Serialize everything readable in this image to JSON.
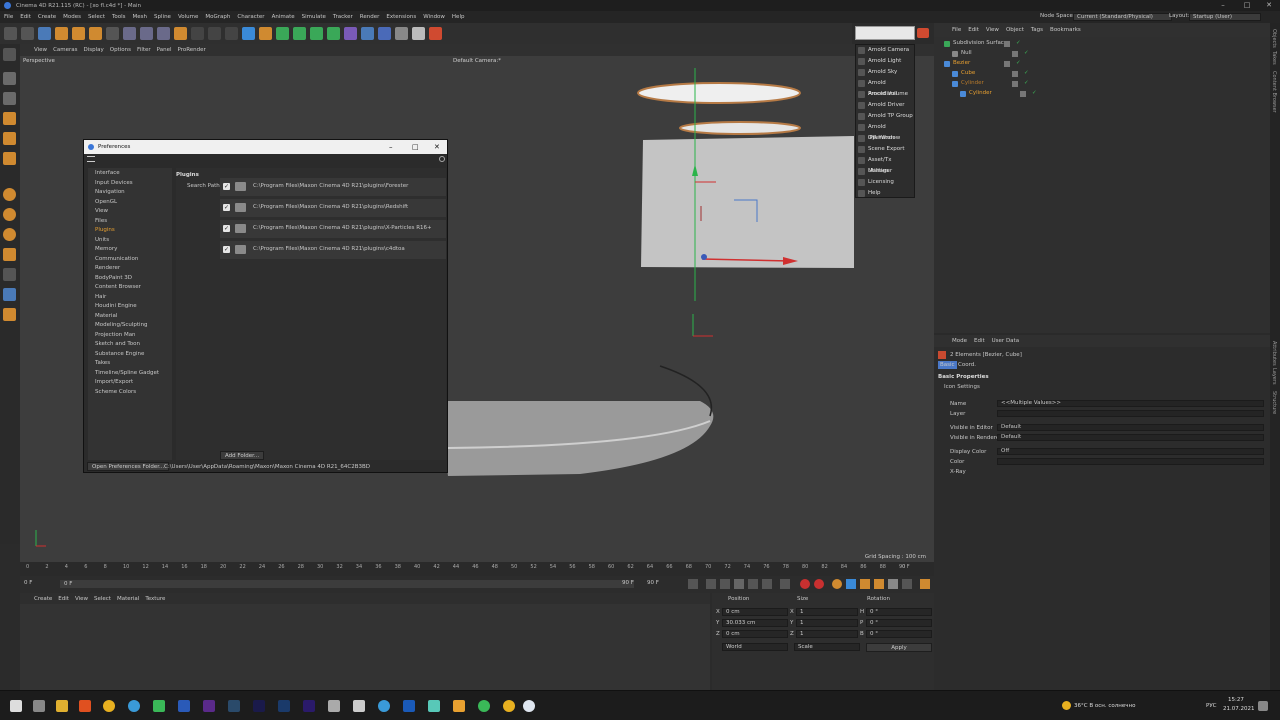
{
  "window": {
    "title": "Cinema 4D R21.115 (RC) - [xo fl.c4d *] - Main"
  },
  "menubar": {
    "items": [
      "File",
      "Edit",
      "Create",
      "Modes",
      "Select",
      "Tools",
      "Mesh",
      "Spline",
      "Volume",
      "MoGraph",
      "Character",
      "Animate",
      "Simulate",
      "Tracker",
      "Render",
      "Extensions",
      "Window",
      "Help"
    ],
    "node_space_label": "Node Space:",
    "node_space_value": "Current (Standard/Physical)",
    "layout_label": "Layout:",
    "layout_value": "Startup (User)"
  },
  "viewport": {
    "menu": [
      "View",
      "Cameras",
      "Display",
      "Options",
      "Filter",
      "Panel",
      "ProRender"
    ],
    "label": "Perspective",
    "camera": "Default Camera:*",
    "grid_spacing": "Grid Spacing : 100 cm"
  },
  "timeline": {
    "ticks": [
      "0",
      "2",
      "4",
      "6",
      "8",
      "10",
      "12",
      "14",
      "16",
      "18",
      "20",
      "22",
      "24",
      "26",
      "28",
      "30",
      "32",
      "34",
      "36",
      "38",
      "40",
      "42",
      "44",
      "46",
      "48",
      "50",
      "52",
      "54",
      "56",
      "58",
      "60",
      "62",
      "64",
      "66",
      "68",
      "70",
      "72",
      "74",
      "76",
      "78",
      "80",
      "82",
      "84",
      "86",
      "88",
      "90"
    ],
    "end_label": "0 F",
    "current_frame": "0 F",
    "start_field": "0 F",
    "end_field_1": "90 F",
    "end_field_2": "90 F"
  },
  "material_bar": {
    "items": [
      "Create",
      "Edit",
      "View",
      "Select",
      "Material",
      "Texture"
    ]
  },
  "coordinates": {
    "headers": [
      "Position",
      "Size",
      "Rotation"
    ],
    "rows": [
      {
        "axis": "X",
        "pos": "0 cm",
        "saxis": "X",
        "size": "1",
        "raxis": "H",
        "rot": "0 °"
      },
      {
        "axis": "Y",
        "pos": "30.033 cm",
        "saxis": "Y",
        "size": "1",
        "raxis": "P",
        "rot": "0 °"
      },
      {
        "axis": "Z",
        "pos": "0 cm",
        "saxis": "Z",
        "size": "1",
        "raxis": "B",
        "rot": "0 °"
      }
    ],
    "mode_world": "World",
    "mode_scale": "Scale",
    "apply": "Apply"
  },
  "object_manager": {
    "menu": [
      "File",
      "Edit",
      "View",
      "Object",
      "Tags",
      "Bookmarks"
    ],
    "objects": [
      {
        "name": "Subdivision Surface",
        "color": "#c8c8c8"
      },
      {
        "name": "Null",
        "color": "#c8c8c8"
      },
      {
        "name": "Bezier",
        "color": "#e8a030"
      },
      {
        "name": "Cube",
        "color": "#e8a030"
      },
      {
        "name": "Cylinder",
        "color": "#b87a2a"
      },
      {
        "name": "Cylinder",
        "color": "#e8a030"
      }
    ]
  },
  "dropdown": {
    "items": [
      "Arnold Camera",
      "Arnold Light",
      "Arnold Sky",
      "Arnold Procedural",
      "Arnold Volume",
      "Arnold Driver",
      "Arnold TP Group",
      "Arnold Operators",
      "IPR Window",
      "Scene Export",
      "Asset/Tx Manager",
      "Utilities",
      "Licensing",
      "Help"
    ]
  },
  "attributes": {
    "menu": [
      "Mode",
      "Edit",
      "User Data"
    ],
    "selection": "2 Elements [Bezier, Cube]",
    "tabs": [
      "Basic",
      "Coord."
    ],
    "section": "Basic Properties",
    "subsection": "Icon Settings",
    "fields": [
      {
        "label": "Name",
        "value": "<<Multiple Values>>"
      },
      {
        "label": "Layer",
        "value": ""
      },
      {
        "label": "Visible in Editor",
        "value": "Default"
      },
      {
        "label": "Visible in Renderer",
        "value": "Default"
      },
      {
        "label": "Display Color",
        "value": "Off"
      },
      {
        "label": "Color",
        "value": ""
      },
      {
        "label": "X-Ray",
        "value": ""
      }
    ]
  },
  "side_tabs": [
    "Objects",
    "Takes",
    "Content Browser",
    "Attributes",
    "Layers",
    "Structure"
  ],
  "preferences": {
    "title": "Preferences",
    "nav": [
      "Interface",
      "Input Devices",
      "Navigation",
      "OpenGL",
      "View",
      "Files",
      "Plugins",
      "Units",
      "Memory",
      "Communication",
      "Renderer",
      "BodyPaint 3D",
      "Content Browser",
      "Hair",
      "Houdini Engine",
      "Material",
      "Modeling/Sculpting",
      "Projection Man",
      "Sketch and Toon",
      "Substance Engine",
      "Takes",
      "Timeline/Spline Gadget",
      "Import/Export",
      "Scheme Colors"
    ],
    "active_nav": "Plugins",
    "section": "Plugins",
    "search_paths_label": "Search Paths",
    "paths": [
      "C:\\Program Files\\Maxon Cinema 4D R21\\plugins\\Forester",
      "C:\\Program Files\\Maxon Cinema 4D R21\\plugins\\Redshift",
      "C:\\Program Files\\Maxon Cinema 4D R21\\plugins\\X-Particles R16+",
      "C:\\Program Files\\Maxon Cinema 4D R21\\plugins\\c4dtoa"
    ],
    "add_folder": "Add Folder...",
    "open_folder": "Open Preferences Folder...",
    "prefs_path": "C:\\Users\\User\\AppData\\Roaming\\Maxon\\Maxon Cinema 4D R21_64C2B3BD"
  },
  "taskbar": {
    "weather": "36°C  В осн. солнечно",
    "lang": "РУС",
    "time": "15:27",
    "date": "21.07.2021"
  }
}
